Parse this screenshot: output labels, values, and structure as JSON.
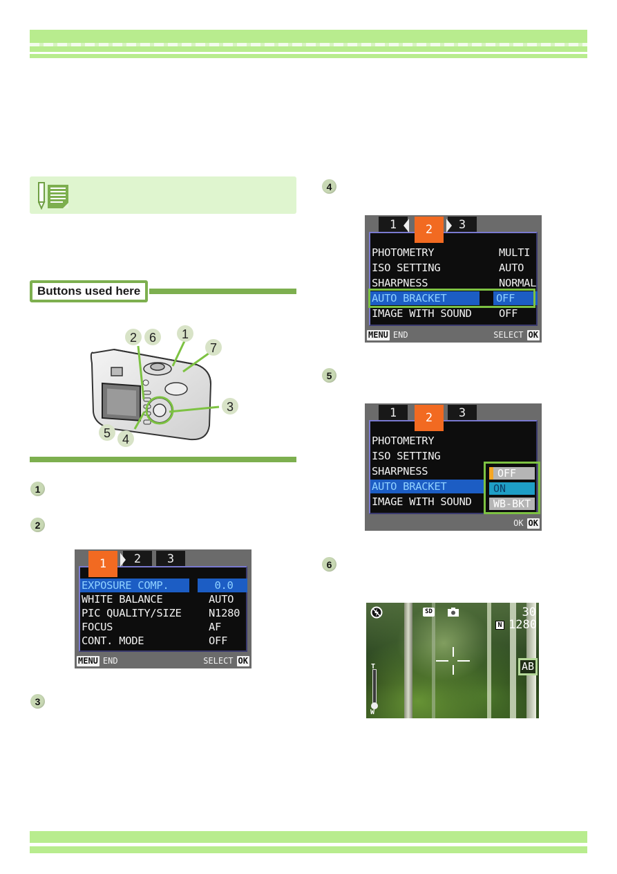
{
  "header": {
    "decoration": "green-banner"
  },
  "memo": {
    "icon": "memo-pencil-icon",
    "text": ""
  },
  "buttons_section": {
    "title": "Buttons used here",
    "callouts": [
      "1",
      "2",
      "6",
      "7",
      "3",
      "5",
      "4"
    ]
  },
  "steps_left": [
    {
      "number": "1"
    },
    {
      "number": "2"
    },
    {
      "number": "3"
    }
  ],
  "steps_right": [
    {
      "number": "4"
    },
    {
      "number": "5"
    },
    {
      "number": "6"
    }
  ],
  "screen1": {
    "tabs": [
      "1",
      "2",
      "3"
    ],
    "active_tab": "1",
    "rows": [
      {
        "label": "EXPOSURE COMP.",
        "value": "0.0",
        "selected": true
      },
      {
        "label": "WHITE BALANCE",
        "value": "AUTO"
      },
      {
        "label": "PIC QUALITY/SIZE",
        "value": "N1280"
      },
      {
        "label": "FOCUS",
        "value": "AF"
      },
      {
        "label": "CONT. MODE",
        "value": "OFF"
      }
    ],
    "footer": {
      "menu_key": "MENU",
      "menu_label": "END",
      "select_label": "SELECT",
      "ok_key": "OK"
    }
  },
  "screen2": {
    "tabs": [
      "1",
      "2",
      "3"
    ],
    "active_tab": "2",
    "rows": [
      {
        "label": "PHOTOMETRY",
        "value": "MULTI"
      },
      {
        "label": "ISO SETTING",
        "value": "AUTO"
      },
      {
        "label": "SHARPNESS",
        "value": "NORMAL"
      },
      {
        "label": "AUTO BRACKET",
        "value": "OFF",
        "selected": true
      },
      {
        "label": "IMAGE WITH SOUND",
        "value": "OFF"
      }
    ],
    "footer": {
      "menu_key": "MENU",
      "menu_label": "END",
      "select_label": "SELECT",
      "ok_key": "OK"
    }
  },
  "screen3": {
    "tabs": [
      "1",
      "2",
      "3"
    ],
    "active_tab": "2",
    "rows": [
      {
        "label": "PHOTOMETRY"
      },
      {
        "label": "ISO SETTING"
      },
      {
        "label": "SHARPNESS"
      },
      {
        "label": "AUTO BRACKET",
        "selected": true
      },
      {
        "label": "IMAGE WITH SOUND"
      }
    ],
    "options": [
      {
        "label": "OFF",
        "state": "current"
      },
      {
        "label": "ON",
        "state": "highlighted"
      },
      {
        "label": "WB-BKT",
        "state": "normal"
      }
    ],
    "footer": {
      "ok_label": "OK",
      "ok_key": "OK"
    }
  },
  "liveview": {
    "flash_icon": "flash-off-icon",
    "card_label": "SD",
    "mode_icon": "camera-mode-icon",
    "shots_remaining": "30",
    "quality_badge": "N",
    "image_size": "1280",
    "bracket_badge": "AB",
    "zoom_labels": {
      "tele": "T",
      "wide": "W"
    }
  },
  "colors": {
    "band_green": "#b8ec8e",
    "rule_green": "#7daf4f",
    "memo_bg": "#dff5cf",
    "tab_orange": "#f26a21",
    "select_blue": "#1c5dc4",
    "highlight_green": "#7dc242"
  }
}
